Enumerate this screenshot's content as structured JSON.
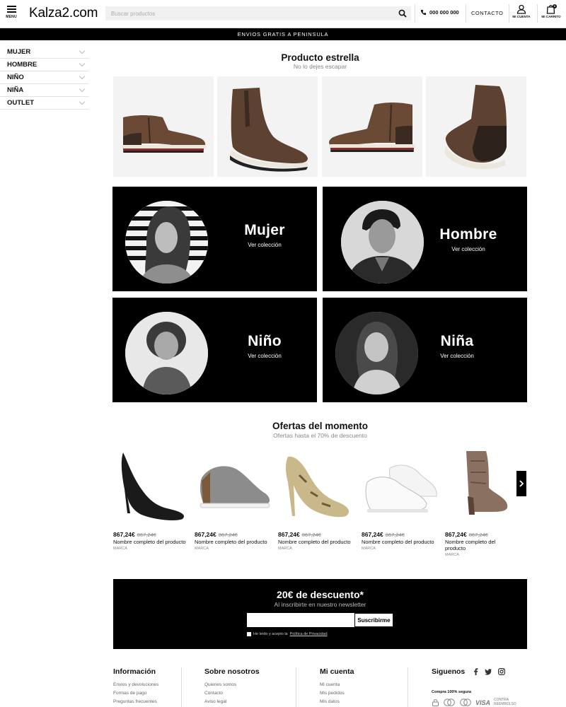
{
  "header": {
    "menu_label": "MENU",
    "logo": "Kalza2.com",
    "search_placeholder": "Buscar productos",
    "phone": "000 000 000",
    "contact": "CONTACTO",
    "account_label": "MI CUENTA",
    "cart_label": "MI CARRITO",
    "cart_count": "0"
  },
  "promo_bar": "ENVIOS GRATIS A PENINSULA",
  "sidebar": {
    "items": [
      {
        "label": "MUJER"
      },
      {
        "label": "HOMBRE"
      },
      {
        "label": "NIÑO"
      },
      {
        "label": "NIÑA"
      },
      {
        "label": "OUTLET"
      }
    ]
  },
  "featured": {
    "title": "Producto estrella",
    "subtitle": "No lo dejes escapar"
  },
  "categories": [
    {
      "name": "Mujer",
      "link": "Ver colección"
    },
    {
      "name": "Hombre",
      "link": "Ver colección"
    },
    {
      "name": "Niño",
      "link": "Ver colección"
    },
    {
      "name": "Niña",
      "link": "Ver colección"
    }
  ],
  "offers": {
    "title": "Ofertas del momento",
    "subtitle": "Ofertas hasta el 70% de descuento",
    "items": [
      {
        "price": "867,24€",
        "old_price": "867,24€",
        "name": "Nombre completo del producto",
        "brand": "MARCA"
      },
      {
        "price": "867,24€",
        "old_price": "867,24€",
        "name": "Nombre completo del producto",
        "brand": "MARCA"
      },
      {
        "price": "867,24€",
        "old_price": "867,24€",
        "name": "Nombre completo del producto",
        "brand": "MARCA"
      },
      {
        "price": "867,24€",
        "old_price": "867,24€",
        "name": "Nombre completo del producto",
        "brand": "MARCA"
      },
      {
        "price": "867,24€",
        "old_price": "867,24€",
        "name": "Nombre completo del producto",
        "brand": "MARCA"
      }
    ]
  },
  "newsletter": {
    "title": "20€ de descuento*",
    "subtitle": "Al inscribirte en nuestro newsletter",
    "button": "Suscribirme",
    "legal_text": "He leído y acepto la",
    "legal_link": "Política de Privacidad"
  },
  "footer": {
    "info": {
      "title": "Información",
      "links": [
        "Envios y devoluciones",
        "Formas de pago",
        "Preguntas frecuentes"
      ]
    },
    "about": {
      "title": "Sobre nosotros",
      "links": [
        "Quienes somos",
        "Contacto",
        "Aviso legal"
      ]
    },
    "account": {
      "title": "Mi cuenta",
      "links": [
        "Mi cuenta",
        "Mis pedidos",
        "Mis datos"
      ]
    },
    "follow": {
      "title": "Siguenos",
      "secure_label": "Compra 100% segura",
      "visa": "VISA",
      "cod": "CONTRA REEMBOLSO"
    }
  },
  "colors": {
    "accent": "#000000",
    "background": "#ffffff",
    "muted": "#888888"
  }
}
